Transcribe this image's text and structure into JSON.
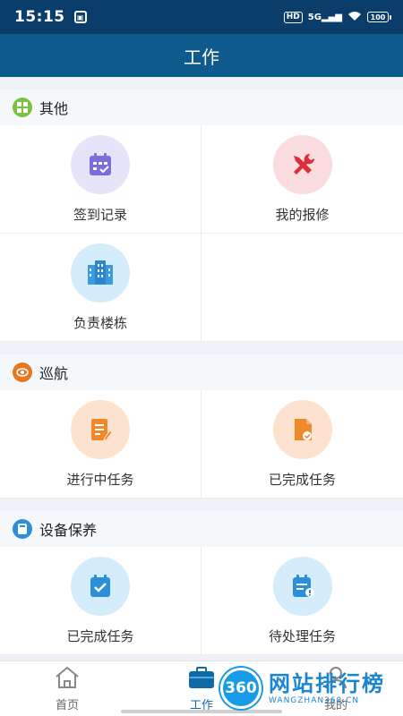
{
  "status_bar": {
    "time": "15:15",
    "hd": "HD",
    "network": "5G",
    "battery": "100"
  },
  "header": {
    "title": "工作"
  },
  "sections": [
    {
      "title": "其他",
      "icon": "grid-icon",
      "color": "#7cc242",
      "items": [
        {
          "label": "签到记录",
          "icon": "calendar-check-icon",
          "bg": "#e6e4f8",
          "fg": "#7a6fd8"
        },
        {
          "label": "我的报修",
          "icon": "repair-tools-icon",
          "bg": "#fbdcdf",
          "fg": "#d9303a"
        },
        {
          "label": "负责楼栋",
          "icon": "building-icon",
          "bg": "#d5ecfa",
          "fg": "#3a9be0"
        }
      ]
    },
    {
      "title": "巡航",
      "icon": "eye-icon",
      "color": "#e87722",
      "items": [
        {
          "label": "进行中任务",
          "icon": "document-edit-icon",
          "bg": "#fde3cf",
          "fg": "#ef8a2b"
        },
        {
          "label": "已完成任务",
          "icon": "document-check-icon",
          "bg": "#fde3cf",
          "fg": "#ef8a2b"
        }
      ]
    },
    {
      "title": "设备保养",
      "icon": "device-icon",
      "color": "#2a8fd8",
      "items": [
        {
          "label": "已完成任务",
          "icon": "calendar-done-icon",
          "bg": "#d5ecfa",
          "fg": "#2a8fd8"
        },
        {
          "label": "待处理任务",
          "icon": "calendar-pending-icon",
          "bg": "#d5ecfa",
          "fg": "#2a8fd8"
        }
      ]
    }
  ],
  "bottom_nav": [
    {
      "label": "首页",
      "icon": "home-icon",
      "active": false
    },
    {
      "label": "工作",
      "icon": "briefcase-icon",
      "active": true
    },
    {
      "label": "我的",
      "icon": "user-icon",
      "active": false
    }
  ],
  "watermark": {
    "logo": "360",
    "title": "网站排行榜",
    "subtitle": "WANGZHAN360.CN"
  }
}
